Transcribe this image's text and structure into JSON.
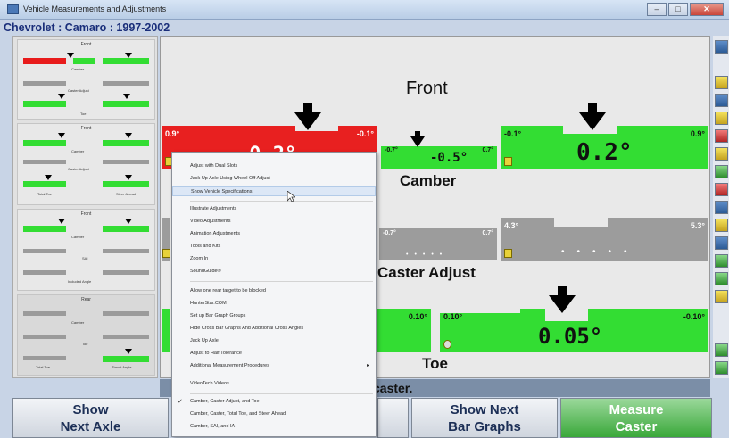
{
  "window": {
    "title": "Vehicle Measurements and Adjustments",
    "controls": [
      "–",
      "□",
      "✕"
    ]
  },
  "vehicle": "Chevrolet : Camaro : 1997-2002",
  "thumbnails": [
    {
      "label": "Front",
      "captions": [
        "Camber",
        "Caster Adjust",
        "Toe"
      ]
    },
    {
      "label": "Front",
      "captions": [
        "Camber",
        "Caster Adjust",
        "Total Toe",
        "Steer Ahead"
      ]
    },
    {
      "label": "Front",
      "captions": [
        "Camber",
        "SAI",
        "Included Angle"
      ]
    },
    {
      "label": "Rear",
      "captions": [
        "Camber",
        "Toe",
        "Total Toe",
        "Thrust Angle"
      ]
    }
  ],
  "main": {
    "section_front": "Front",
    "camber": {
      "label": "Camber",
      "left": {
        "min": "0.9°",
        "max": "-0.1°",
        "value": "-0.2°"
      },
      "center": {
        "min": "-0.7°",
        "max": "0.7°",
        "value": "-0.5°"
      },
      "right": {
        "min": "-0.1°",
        "max": "0.9°",
        "value": "0.2°"
      }
    },
    "caster": {
      "label": "Caster Adjust",
      "center": {
        "min": "-0.7°",
        "max": "0.7°"
      },
      "right": {
        "min": "4.3°",
        "max": "5.3°"
      }
    },
    "toe": {
      "label": "Toe",
      "left": {
        "max": "0.10°"
      },
      "right": {
        "min": "0.10°",
        "max": "-0.10°",
        "value": "0.05°"
      }
    }
  },
  "instruction": "Adjust caster.",
  "instruction_visible": "caster.",
  "fkeys": [
    {
      "line1": "Show",
      "line2": "Next Axle"
    },
    {
      "line1": "Show Next",
      "line2": "Bar Graphs"
    },
    {
      "line1": "Measure",
      "line2": "Caster"
    }
  ],
  "context_menu": {
    "items": [
      "Adjust with Dual Slots",
      "Jack Up Axle Using Wheel Off Adjust",
      "Show Vehicle Specifications",
      "Illustrate Adjustments",
      "Video Adjustments",
      "Animation Adjustments",
      "Tools and Kits",
      "Zoom In",
      "SoundGuide®",
      "Allow one rear target to be blocked",
      "HunterStar.COM",
      "Set up Bar Graph Groups",
      "Hide Cross Bar Graphs And Additional Cross Angles",
      "Jack Up Axle",
      "Adjust to Half Tolerance",
      "Additional Measurement Procedures",
      "VideoTech Videos",
      "Camber, Caster Adjust, and Toe",
      "Camber, Caster, Total Toe, and Steer Ahead",
      "Camber, SAI, and IA"
    ],
    "highlighted_index": 2,
    "checked_index": 17,
    "submenu_index": 15
  },
  "colors": {
    "in_spec": "#33dd33",
    "out_of_spec": "#e82020",
    "neutral": "#9c9c9c",
    "vehicle_text": "#1a2e7a"
  }
}
